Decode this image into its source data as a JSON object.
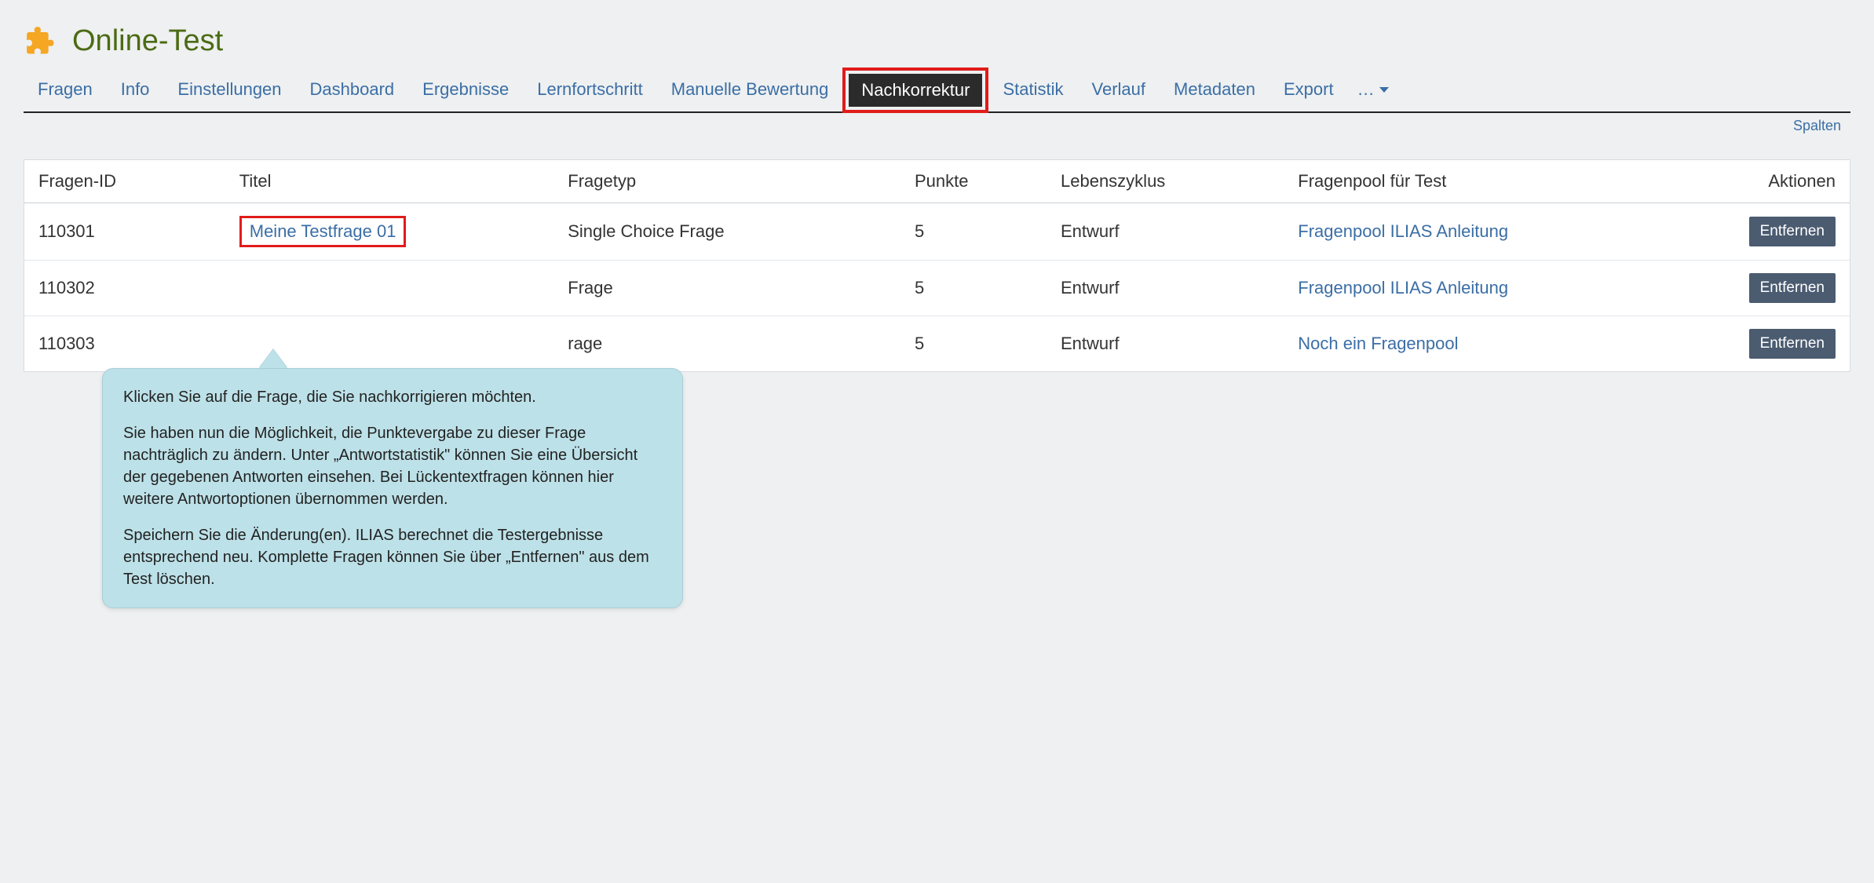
{
  "header": {
    "title": "Online-Test"
  },
  "tabs": [
    {
      "label": "Fragen",
      "active": false
    },
    {
      "label": "Info",
      "active": false
    },
    {
      "label": "Einstellungen",
      "active": false
    },
    {
      "label": "Dashboard",
      "active": false
    },
    {
      "label": "Ergebnisse",
      "active": false
    },
    {
      "label": "Lernfortschritt",
      "active": false
    },
    {
      "label": "Manuelle Bewertung",
      "active": false
    },
    {
      "label": "Nachkorrektur",
      "active": true,
      "highlighted": true
    },
    {
      "label": "Statistik",
      "active": false
    },
    {
      "label": "Verlauf",
      "active": false
    },
    {
      "label": "Metadaten",
      "active": false
    },
    {
      "label": "Export",
      "active": false
    }
  ],
  "more_menu": {
    "label": "…"
  },
  "columns_link": "Spalten",
  "table": {
    "headers": {
      "id": "Fragen-ID",
      "title": "Titel",
      "type": "Fragetyp",
      "points": "Punkte",
      "lifecycle": "Lebenszyklus",
      "pool": "Fragenpool für Test",
      "actions": "Aktionen"
    },
    "rows": [
      {
        "id": "110301",
        "title": "Meine Testfrage 01",
        "title_highlighted": true,
        "type": "Single Choice Frage",
        "points": "5",
        "lifecycle": "Entwurf",
        "pool": "Fragenpool ILIAS Anleitung",
        "action_label": "Entfernen"
      },
      {
        "id": "110302",
        "title": "",
        "type": "Frage",
        "points": "5",
        "lifecycle": "Entwurf",
        "pool": "Fragenpool ILIAS Anleitung",
        "action_label": "Entfernen"
      },
      {
        "id": "110303",
        "title": "",
        "type": "rage",
        "points": "5",
        "lifecycle": "Entwurf",
        "pool": "Noch ein Fragenpool",
        "action_label": "Entfernen"
      }
    ]
  },
  "callout": {
    "p1": "Klicken Sie auf die Frage, die Sie nachkorrigieren möchten.",
    "p2": "Sie haben nun die Möglichkeit, die Punktevergabe zu dieser Frage nachträglich zu ändern. Unter „Antwortstatistik\" können Sie eine Übersicht der gegebenen Antworten einsehen. Bei Lückentextfragen können hier weitere Antwortoptionen übernommen werden.",
    "p3": "Speichern Sie die Änderung(en). ILIAS berechnet die Testergebnisse entsprechend neu. Komplette Fragen können Sie über „Entfernen\" aus dem Test löschen."
  }
}
